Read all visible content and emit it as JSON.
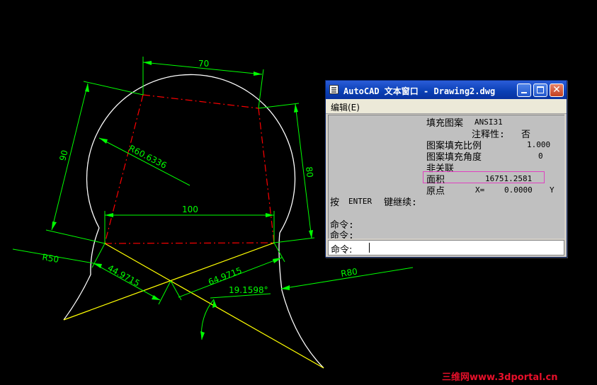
{
  "window": {
    "title": "AutoCAD 文本窗口 - Drawing2.dwg",
    "menu_edit": "编辑(E)",
    "controls": {
      "minimize_icon": "minimize-icon",
      "maximize_icon": "maximize-icon",
      "close_glyph": "✕"
    }
  },
  "output": {
    "hatch_pattern_label": "填充图案",
    "hatch_pattern_value": "ANSI31",
    "annotative_label": "注释性:",
    "annotative_value": "否",
    "scale_label": "图案填充比例",
    "scale_value": "1.000",
    "angle_label": "图案填充角度",
    "angle_value": "0",
    "assoc_label": "非关联",
    "area_label": "面积",
    "area_value": "16751.2581",
    "origin_label": "原点",
    "origin_x_label": "X=",
    "origin_x_value": "0.0000",
    "origin_y_label": "Y",
    "continue_prefix": "按",
    "continue_key": "ENTER",
    "continue_suffix": "键继续:",
    "cmd1": "命令:",
    "cmd2": "命令:"
  },
  "command_line": {
    "prompt": "命令:"
  },
  "drawing": {
    "dims": {
      "top_width": "70",
      "left_height": "90",
      "right_height": "80",
      "mid_width": "100",
      "radius_circle": "R60.6336",
      "radius_left": "R50",
      "radius_right": "R80",
      "dist_left": "44.9715",
      "dist_right": "64.9715",
      "angle": "19.1598°"
    }
  },
  "watermark": "三维网www.3dportal.cn",
  "colors": {
    "dimension": "#00ff00",
    "hidden_line": "#ff0000",
    "construction": "#ffff00",
    "outline": "#ffffff",
    "highlight_box": "#e040c0"
  }
}
